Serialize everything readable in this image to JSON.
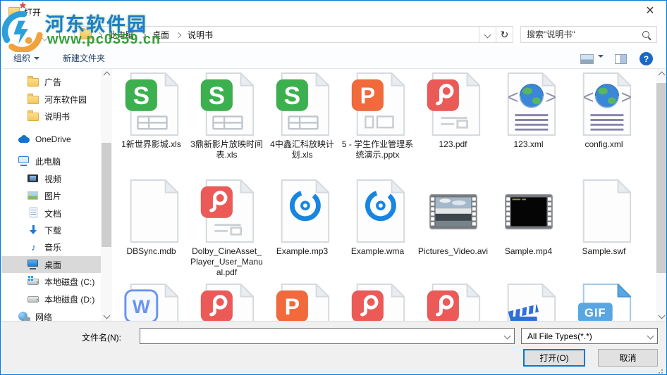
{
  "window": {
    "title": "打开",
    "close_glyph": "×"
  },
  "watermark": {
    "line1": "河东软件园",
    "line2": "www.pc0359.cn"
  },
  "nav": {
    "breadcrumb": [
      "此电脑",
      "桌面",
      "说明书"
    ],
    "search_placeholder": "搜索\"说明书\"",
    "up_arrow_glyph": "↑",
    "refresh_glyph": "↻"
  },
  "toolbar": {
    "organize": "组织",
    "new_folder": "新建文件夹",
    "help_glyph": "?"
  },
  "sidebar": {
    "items": [
      {
        "label": "广告",
        "icon": "folder"
      },
      {
        "label": "河东软件园",
        "icon": "folder"
      },
      {
        "label": "说明书",
        "icon": "folder"
      },
      {
        "label": "OneDrive",
        "icon": "onedrive"
      },
      {
        "label": "此电脑",
        "icon": "computer"
      },
      {
        "label": "视频",
        "icon": "videos"
      },
      {
        "label": "图片",
        "icon": "pictures"
      },
      {
        "label": "文档",
        "icon": "documents"
      },
      {
        "label": "下载",
        "icon": "downloads"
      },
      {
        "label": "音乐",
        "icon": "music"
      },
      {
        "label": "桌面",
        "icon": "desktop",
        "selected": true
      },
      {
        "label": "本地磁盘 (C:)",
        "icon": "drive-windows"
      },
      {
        "label": "本地磁盘 (D:)",
        "icon": "drive"
      },
      {
        "label": "网络",
        "icon": "network"
      }
    ],
    "music_note_glyph": "♪"
  },
  "files": {
    "items": [
      {
        "name": "1新世界影城.xls",
        "icon": "wps-xls"
      },
      {
        "name": "3鼎新影片放映时间表.xls",
        "icon": "wps-xls"
      },
      {
        "name": "4中鑫汇科放映计划.xls",
        "icon": "wps-xls"
      },
      {
        "name": "5 - 学生作业管理系统演示.pptx",
        "icon": "wps-pptx"
      },
      {
        "name": "123.pdf",
        "icon": "wps-pdf"
      },
      {
        "name": "123.xml",
        "icon": "xml"
      },
      {
        "name": "config.xml",
        "icon": "xml"
      },
      {
        "name": "DBSync.mdb",
        "icon": "blank"
      },
      {
        "name": "Dolby_CineAsset_Player_User_Manual.pdf",
        "icon": "wps-pdf"
      },
      {
        "name": "Example.mp3",
        "icon": "audio"
      },
      {
        "name": "Example.wma",
        "icon": "audio"
      },
      {
        "name": "Pictures_Video.avi",
        "icon": "video-avi"
      },
      {
        "name": "Sample.mp4",
        "icon": "video-mp4"
      },
      {
        "name": "Sample.swf",
        "icon": "blank"
      }
    ],
    "partial_row_icons": [
      "wps-docx",
      "wps-pdf",
      "wps-pptx",
      "wps-pdf",
      "wps-pdf",
      "clapper",
      "gif"
    ]
  },
  "footer": {
    "filename_label": "文件名(N):",
    "filename_value": "",
    "filetype_value": "All File Types(*.*)",
    "open_label": "打开(O)",
    "cancel_label": "取消"
  },
  "colors": {
    "accent": "#0078d7",
    "wps_sheet_green": "#3cb04e",
    "wps_ppt_orange": "#f2693b",
    "wps_pdf_red": "#ec5a57",
    "xml_line_purple": "#8787ab",
    "audio_blue": "#1886e0",
    "selected_sidebar_gray": "#d9d9d9"
  }
}
